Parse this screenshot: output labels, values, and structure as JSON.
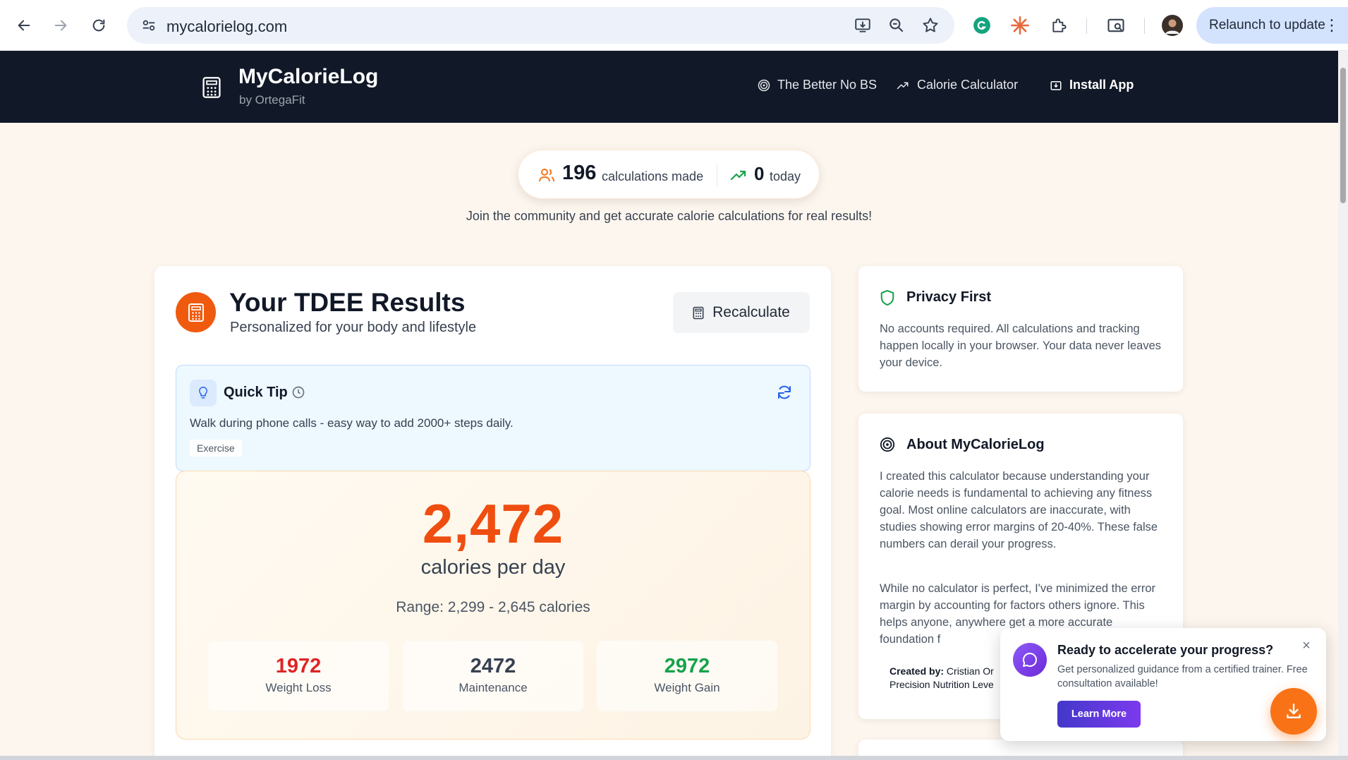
{
  "browser": {
    "url": "mycalorielog.com",
    "relaunch_label": "Relaunch to update",
    "menu_glyph": "⋮"
  },
  "header": {
    "brand_title": "MyCalorieLog",
    "brand_sub": "by OrtegaFit",
    "links": [
      {
        "label": "The Better No BS",
        "icon": "target-icon"
      },
      {
        "label": "Calorie Calculator",
        "icon": "trend-up-icon"
      },
      {
        "label": "Install App",
        "icon": "install-icon"
      }
    ]
  },
  "stats": {
    "calculations_count": "196",
    "calculations_label": "calculations made",
    "today_count": "0",
    "today_label": "today",
    "tagline": "Join the community and get accurate calorie calculations for real results!"
  },
  "results": {
    "title": "Your TDEE Results",
    "subtitle": "Personalized for your body and lifestyle",
    "recalculate_label": "Recalculate"
  },
  "tip": {
    "title": "Quick Tip",
    "text": "Walk during phone calls - easy way to add 2000+ steps daily.",
    "tag": "Exercise"
  },
  "calories": {
    "value": "2,472",
    "unit": "calories per day",
    "range": "Range: 2,299 - 2,645 calories",
    "goals": [
      {
        "value": "1972",
        "label": "Weight Loss",
        "color": "#dc2626"
      },
      {
        "value": "2472",
        "label": "Maintenance",
        "color": "#374151"
      },
      {
        "value": "2972",
        "label": "Weight Gain",
        "color": "#16a34a"
      }
    ]
  },
  "privacy": {
    "title": "Privacy First",
    "text": "No accounts required. All calculations and tracking happen locally in your browser. Your data never leaves your device."
  },
  "about": {
    "title": "About MyCalorieLog",
    "para1": "I created this calculator because understanding your calorie needs is fundamental to achieving any fitness goal. Most online calculators are inaccurate, with studies showing error margins of 20-40%. These false numbers can derail your progress.",
    "para2": "While no calculator is perfect, I've minimized the error margin by accounting for factors others ignore. This helps anyone, anywhere get a more accurate foundation f",
    "created_by_label": "Created by:",
    "created_by_name": "Cristian Or",
    "credential": "Precision Nutrition Leve"
  },
  "popup": {
    "title": "Ready to accelerate your progress?",
    "text": "Get personalized guidance from a certified trainer. Free consultation available!",
    "button": "Learn More",
    "close": "×"
  },
  "colors": {
    "accent": "#ef4e10",
    "header_bg": "#111827",
    "page_bg": "#fdf6ee"
  }
}
